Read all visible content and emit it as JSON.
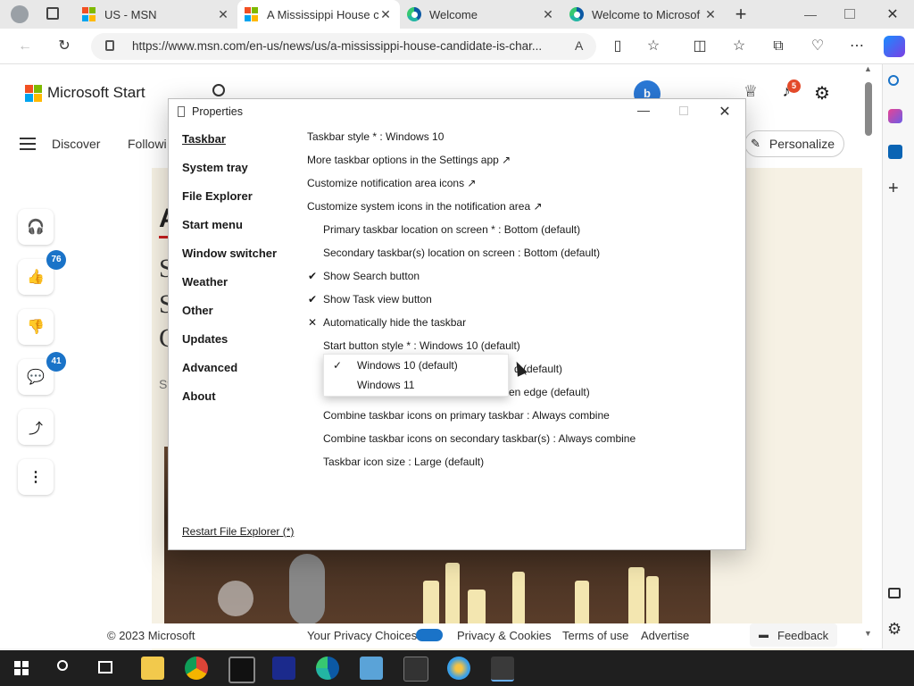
{
  "browser": {
    "tabs": [
      {
        "title": "US - MSN"
      },
      {
        "title": "A Mississippi House c"
      },
      {
        "title": "Welcome"
      },
      {
        "title": "Welcome to Microsof"
      }
    ],
    "url": "https://www.msn.com/en-us/news/us/a-mississippi-house-candidate-is-char..."
  },
  "msn": {
    "brand": "Microsoft Start",
    "nav": [
      "Discover",
      "Followi"
    ],
    "personalize": "Personalize",
    "notifications_count": "5",
    "likes_count": "76",
    "comments_count": "41",
    "article_partial": [
      "A",
      "S",
      "C",
      "St"
    ],
    "footer": {
      "copyright": "© 2023 Microsoft",
      "links": [
        "Your Privacy Choices",
        "Privacy & Cookies",
        "Terms of use",
        "Advertise"
      ],
      "feedback": "Feedback"
    }
  },
  "dialog": {
    "title": "Properties",
    "nav": [
      "Taskbar",
      "System tray",
      "File Explorer",
      "Start menu",
      "Window switcher",
      "Weather",
      "Other",
      "Updates",
      "Advanced",
      "About"
    ],
    "options": [
      "Taskbar style * : Windows 10",
      "More taskbar options in the Settings app ↗",
      "Customize notification area icons ↗",
      "Customize system icons in the notification area ↗",
      "Primary taskbar location on screen * : Bottom (default)",
      "Secondary taskbar(s) location on screen : Bottom (default)",
      "Show Search button",
      "Show Task view button",
      "Automatically hide the taskbar",
      "Start button style * : Windows 10 (default)",
      "d (default)",
      "en edge (default)",
      "Combine taskbar icons on primary taskbar : Always combine",
      "Combine taskbar icons on secondary taskbar(s) : Always combine",
      "Taskbar icon size : Large (default)"
    ],
    "marks": {
      "search": "✔",
      "taskview": "✔",
      "autohide": "✕"
    },
    "dropdown": {
      "items": [
        "Windows 10 (default)",
        "Windows 11"
      ],
      "check": "✓"
    },
    "restart_link": "Restart File Explorer (*)"
  },
  "colors": {
    "accent": "#1a73c8",
    "badge_red": "#e34a2a"
  }
}
